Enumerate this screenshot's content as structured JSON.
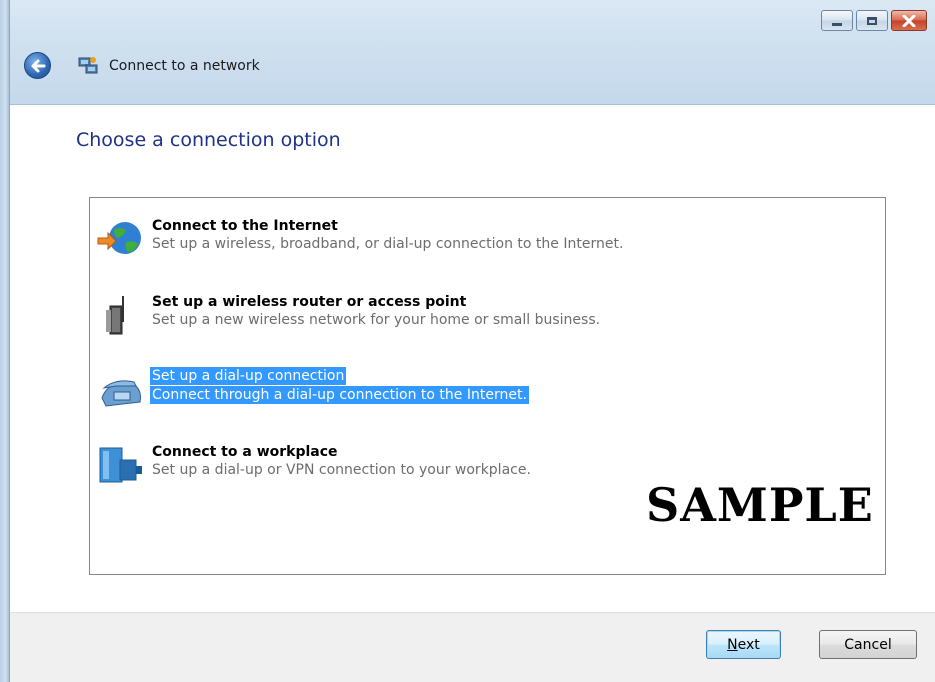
{
  "window": {
    "title": "Connect to a network",
    "caption_buttons": [
      "minimize",
      "maximize",
      "close"
    ]
  },
  "heading": "Choose a connection option",
  "options": [
    {
      "title": "Connect to the Internet",
      "description": "Set up a wireless, broadband, or dial-up connection to the Internet.",
      "icon": "globe-icon",
      "selected": false
    },
    {
      "title": "Set up a wireless router or access point",
      "description": "Set up a new wireless network for your home or small business.",
      "icon": "router-icon",
      "selected": false
    },
    {
      "title": "Set up a dial-up connection",
      "description": "Connect through a dial-up connection to the Internet.",
      "icon": "phone-icon",
      "selected": true
    },
    {
      "title": "Connect to a workplace",
      "description": "Set up a dial-up or VPN connection to your workplace.",
      "icon": "workplace-icon",
      "selected": false
    }
  ],
  "watermark": "SAMPLE",
  "footer": {
    "next_label_underlined": "N",
    "next_label_rest": "ext",
    "cancel_label": "Cancel"
  },
  "colors": {
    "heading": "#1e3287",
    "selection": "#3399ff"
  }
}
